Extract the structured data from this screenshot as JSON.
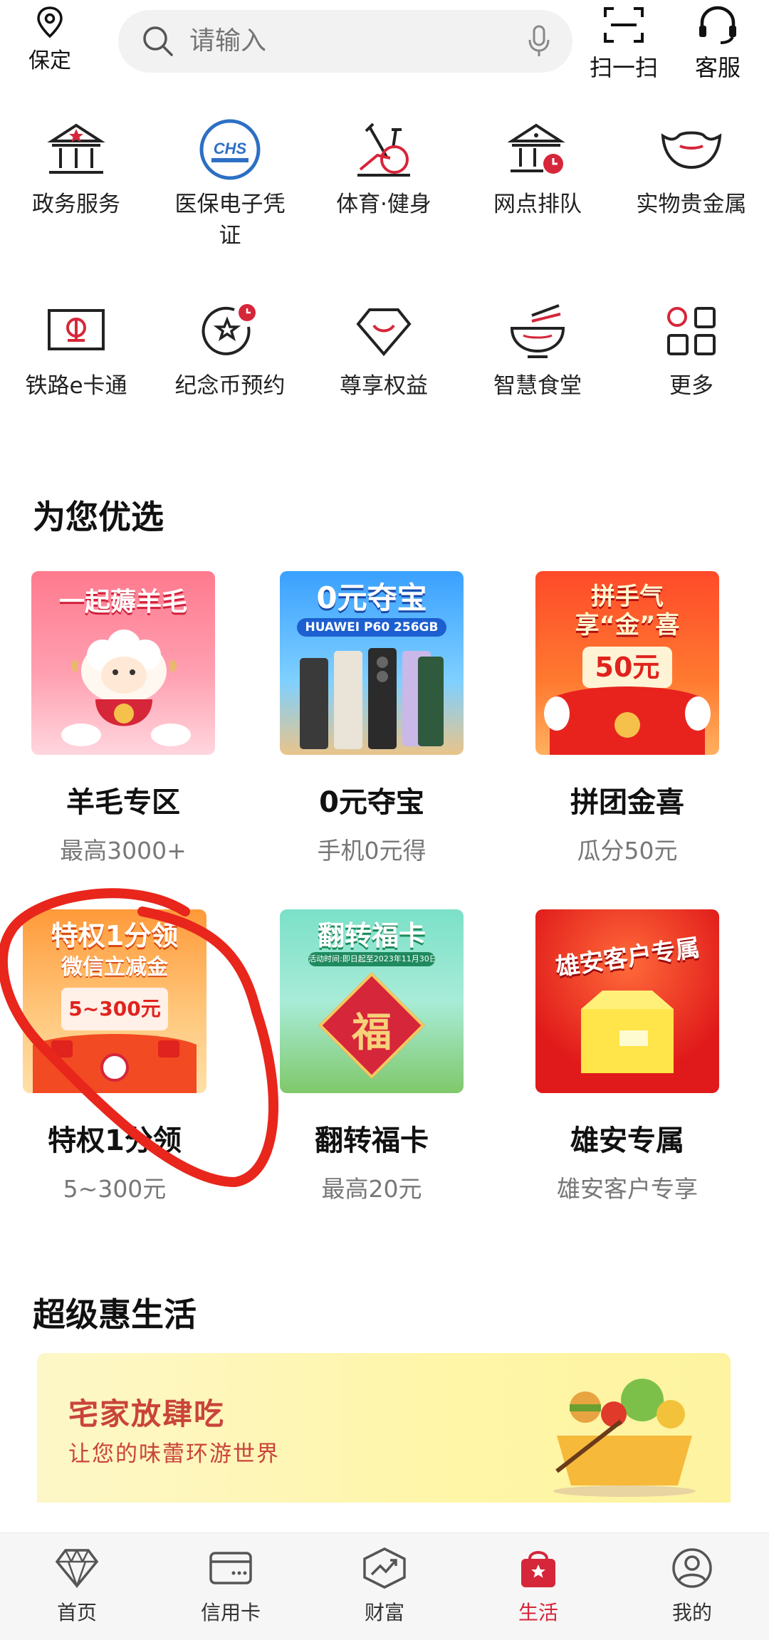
{
  "top": {
    "location": "保定",
    "search_placeholder": "请输入",
    "scan": "扫一扫",
    "service": "客服"
  },
  "services": [
    {
      "label": "政务服务",
      "icon": "government-building-icon"
    },
    {
      "label": "医保电子凭\n证",
      "icon": "chs-medical-insurance-icon"
    },
    {
      "label": "体育·健身",
      "icon": "exercise-bike-icon"
    },
    {
      "label": "网点排队",
      "icon": "bank-queue-icon"
    },
    {
      "label": "实物贵金属",
      "icon": "gold-ingot-icon"
    },
    {
      "label": "铁路e卡通",
      "icon": "railway-card-icon"
    },
    {
      "label": "纪念币预约",
      "icon": "commemorative-coin-icon"
    },
    {
      "label": "尊享权益",
      "icon": "diamond-icon"
    },
    {
      "label": "智慧食堂",
      "icon": "bowl-icon"
    },
    {
      "label": "更多",
      "icon": "more-grid-icon"
    }
  ],
  "section1": {
    "title": "为您优选"
  },
  "tiles": [
    {
      "title": "羊毛专区",
      "sub": "最高3000+",
      "img_text": "一起薅羊毛"
    },
    {
      "title": "0元夺宝",
      "sub": "手机0元得",
      "img_text": "0元夺宝",
      "img_text2": "HUAWEI P60 256GB"
    },
    {
      "title": "拼团金喜",
      "sub": "瓜分50元",
      "img_text": "拼手气",
      "img_text2": "享“金”喜",
      "img_text3": "50元"
    },
    {
      "title": "特权1分领",
      "sub": "5~300元",
      "img_text": "特权1分领",
      "img_text2": "微信立减金",
      "img_text3": "5~300元"
    },
    {
      "title": "翻转福卡",
      "sub": "最高20元",
      "img_text": "翻转福卡",
      "img_text2": "活动时间:即日起至2023年11月30日",
      "img_text3": "福"
    },
    {
      "title": "雄安专属",
      "sub": "雄安客户专享",
      "img_text": "雄安客户专属"
    }
  ],
  "section2": {
    "title": "超级惠生活"
  },
  "banner": {
    "title": "宅家放肆吃",
    "subtitle": "让您的味蕾环游世界"
  },
  "nav": [
    {
      "label": "首页",
      "icon": "diamond-home-icon"
    },
    {
      "label": "信用卡",
      "icon": "credit-card-icon"
    },
    {
      "label": "财富",
      "icon": "wealth-chart-icon"
    },
    {
      "label": "生活",
      "icon": "shopping-bag-icon",
      "active": true
    },
    {
      "label": "我的",
      "icon": "user-icon"
    }
  ],
  "colors": {
    "accent": "#d6263a",
    "annotation": "#e8261c"
  }
}
